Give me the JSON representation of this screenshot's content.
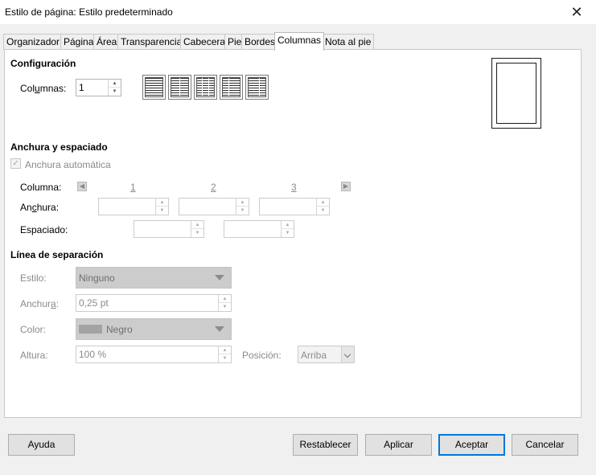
{
  "window": {
    "title": "Estilo de página: Estilo predeterminado",
    "close_icon": "close-icon"
  },
  "tabs": [
    {
      "label": "Organizador"
    },
    {
      "label": "Página"
    },
    {
      "label": "Área"
    },
    {
      "label": "Transparencia"
    },
    {
      "label": "Cabecera"
    },
    {
      "label": "Pie"
    },
    {
      "label": "Bordes"
    },
    {
      "label": "Columnas",
      "active": true
    },
    {
      "label": "Nota al pie"
    }
  ],
  "config": {
    "heading": "Configuración",
    "columns_label_pre": "Col",
    "columns_label_ul": "u",
    "columns_label_post": "mnas:",
    "columns_value": "1",
    "presets": [
      "1 column",
      "2 columns",
      "3 columns",
      "2 columns left",
      "2 columns right"
    ]
  },
  "width_spacing": {
    "heading": "Anchura y espaciado",
    "auto_width": "Anchura automática",
    "auto_width_checked": true,
    "column_label": "Columna:",
    "column_numbers": [
      "1",
      "2",
      "3"
    ],
    "width_label_pre": "An",
    "width_label_ul": "c",
    "width_label_post": "hura:",
    "spacing_label": "Espaciado:"
  },
  "separator": {
    "heading": "Línea de separación",
    "style_label": "Estilo:",
    "style_value": "Ninguno",
    "width_label_pre": "Anchur",
    "width_label_ul": "a",
    "width_label_post": ":",
    "width_value": "0,25 pt",
    "color_label": "Color:",
    "color_value": "Negro",
    "height_label": "Altura:",
    "height_value": "100 %",
    "position_label": "Posición:",
    "position_value": "Arriba"
  },
  "buttons": {
    "help": "Ayuda",
    "reset": "Restablecer",
    "apply": "Aplicar",
    "ok": "Aceptar",
    "cancel": "Cancelar"
  }
}
